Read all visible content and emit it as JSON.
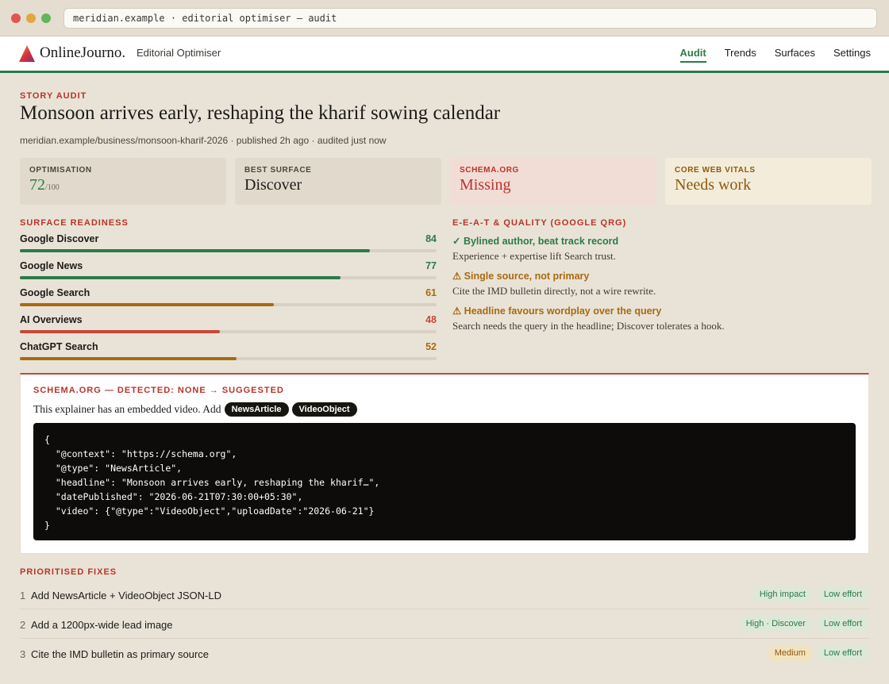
{
  "browser": {
    "url": "meridian.example · editorial optimiser — audit",
    "dots": [
      "#e0574f",
      "#e1a73b",
      "#63b557"
    ]
  },
  "app": {
    "brand": "OnlineJourno.",
    "subbrand": "Editorial Optimiser",
    "nav": [
      {
        "label": "Audit",
        "active": true
      },
      {
        "label": "Trends",
        "active": false
      },
      {
        "label": "Surfaces",
        "active": false
      },
      {
        "label": "Settings",
        "active": false
      }
    ]
  },
  "story": {
    "eyebrow": "STORY AUDIT",
    "title": "Monsoon arrives early, reshaping the kharif sowing calendar",
    "meta": "meridian.example/business/monsoon-kharif-2026 · published 2h ago · audited just now"
  },
  "cards": [
    {
      "label": "OPTIMISATION",
      "value": "72",
      "suffix": "/100",
      "bg": "#e1dacc",
      "color": "#2d7a49",
      "labelColor": "#4a463e"
    },
    {
      "label": "BEST SURFACE",
      "value": "Discover",
      "suffix": "",
      "bg": "#e1dacc",
      "color": "#1c1b19",
      "labelColor": "#4a463e"
    },
    {
      "label": "SCHEMA.ORG",
      "value": "Missing",
      "suffix": "",
      "bg": "#f2dcd6",
      "color": "#b8342a",
      "labelColor": "#b8342a"
    },
    {
      "label": "CORE WEB VITALS",
      "value": "Needs work",
      "suffix": "",
      "bg": "#f4ecda",
      "color": "#8b5a0e",
      "labelColor": "#8b5a0e"
    }
  ],
  "readiness": {
    "title": "SURFACE READINESS",
    "items": [
      {
        "name": "Google Discover",
        "score": "84",
        "value": 84,
        "color": "#2d7a49"
      },
      {
        "name": "Google News",
        "score": "77",
        "value": 77,
        "color": "#2d7a49"
      },
      {
        "name": "Google Search",
        "score": "61",
        "value": 61,
        "color": "#a86a12"
      },
      {
        "name": "AI Overviews",
        "score": "48",
        "value": 48,
        "color": "#c7473b"
      },
      {
        "name": "ChatGPT Search",
        "score": "52",
        "value": 52,
        "color": "#a86a12"
      }
    ]
  },
  "eeat": {
    "title": "E-E-A-T & QUALITY (GOOGLE QRG)",
    "items": [
      {
        "head": "✓ Bylined author, beat track record",
        "body": "Experience + expertise lift Search trust.",
        "color": "#2d7a49"
      },
      {
        "head": "⚠ Single source, not primary",
        "body": "Cite the IMD bulletin directly, not a wire rewrite.",
        "color": "#a86a12"
      },
      {
        "head": "⚠ Headline favours wordplay over the query",
        "body": "Search needs the query in the headline; Discover tolerates a hook.",
        "color": "#a86a12"
      }
    ]
  },
  "schema": {
    "title": "SCHEMA.ORG — DETECTED: NONE → SUGGESTED",
    "intro": "This explainer has an embedded video. Add",
    "pills": [
      "NewsArticle",
      "VideoObject"
    ],
    "code": "{\n  \"@context\": \"https://schema.org\",\n  \"@type\": \"NewsArticle\",\n  \"headline\": \"Monsoon arrives early, reshaping the kharif…\",\n  \"datePublished\": \"2026-06-21T07:30:00+05:30\",\n  \"video\": {\"@type\":\"VideoObject\",\"uploadDate\":\"2026-06-21\"}\n}"
  },
  "fixes": {
    "title": "PRIORITISED FIXES",
    "items": [
      {
        "num": "1",
        "text": "Add NewsArticle + VideoObject JSON-LD",
        "tags": [
          {
            "label": "High impact",
            "tone": "green"
          },
          {
            "label": "Low effort",
            "tone": "green"
          }
        ]
      },
      {
        "num": "2",
        "text": "Add a 1200px-wide lead image",
        "tags": [
          {
            "label": "High · Discover",
            "tone": "green"
          },
          {
            "label": "Low effort",
            "tone": "green"
          }
        ]
      },
      {
        "num": "3",
        "text": "Cite the IMD bulletin as primary source",
        "tags": [
          {
            "label": "Medium",
            "tone": "amber"
          },
          {
            "label": "Low effort",
            "tone": "green"
          }
        ]
      }
    ]
  }
}
